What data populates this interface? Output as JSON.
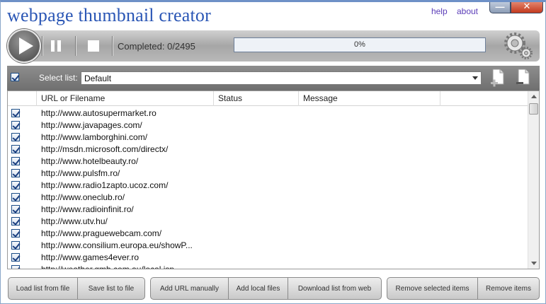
{
  "app": {
    "title": "webpage thumbnail creator",
    "links": {
      "help": "help",
      "about": "about"
    },
    "window_controls": {
      "minimize": "—",
      "close": "✕"
    }
  },
  "toolbar": {
    "completed_text": "Completed: 0/2495",
    "progress_text": "0%",
    "progress_fraction": 0,
    "icons": [
      "play-icon",
      "pause-icon",
      "stop-icon",
      "gear-icon"
    ]
  },
  "list_select": {
    "label": "Select list:",
    "value": "Default",
    "icons": [
      "add-document-icon",
      "remove-document-icon"
    ]
  },
  "table": {
    "columns": [
      "URL or Filename",
      "Status",
      "Message"
    ],
    "rows": [
      "http://www.autosupermarket.ro",
      "http://www.javapages.com/",
      "http://www.lamborghini.com/",
      "http://msdn.microsoft.com/directx/",
      "http://www.hotelbeauty.ro/",
      "http://www.pulsfm.ro/",
      "http://www.radio1zapto.ucoz.com/",
      "http://www.oneclub.ro/",
      "http://www.radioinfinit.ro/",
      "http://www.utv.hu/",
      "http://www.praguewebcam.com/",
      "http://www.consilium.europa.eu/showP...",
      "http://www.games4ever.ro",
      "http://weather.gmb.com.au/local.jsp"
    ]
  },
  "bottom_buttons": {
    "load": "Load list from file",
    "save": "Save list to file",
    "add_url": "Add URL manually",
    "add_local": "Add local files",
    "download": "Download list from web",
    "remove_selected": "Remove selected items",
    "remove_items": "Remove items"
  },
  "colors": {
    "title": "#2a56b5",
    "links": "#5b3db8",
    "toolbar": "#b0b0b0",
    "listbar": "#7a7a7a"
  }
}
